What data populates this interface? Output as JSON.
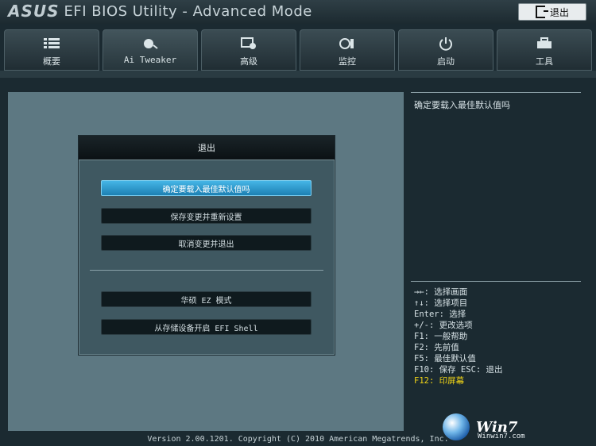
{
  "header": {
    "brand": "ASUS",
    "title": "EFI BIOS Utility - Advanced Mode",
    "exit_label": "退出"
  },
  "tabs": [
    {
      "label": "概要",
      "icon": "list-icon"
    },
    {
      "label": "Ai Tweaker",
      "icon": "ai-tweaker-icon"
    },
    {
      "label": "高级",
      "icon": "advanced-icon"
    },
    {
      "label": "监控",
      "icon": "monitor-icon"
    },
    {
      "label": "启动",
      "icon": "power-icon"
    },
    {
      "label": "工具",
      "icon": "toolbox-icon"
    }
  ],
  "dialog": {
    "title": "退出",
    "buttons": [
      "确定要载入最佳默认值吗",
      "保存变更并重新设置",
      "取消变更并退出",
      "华硕 EZ 模式",
      "从存储设备开启 EFI Shell"
    ]
  },
  "right_panel": {
    "description": "确定要载入最佳默认值吗",
    "hotkeys": [
      "→←: 选择画面",
      "↑↓: 选择项目",
      "Enter: 选择",
      "+/-: 更改选项",
      "F1: 一般帮助",
      "F2: 先前值",
      "F5: 最佳默认值",
      "F10: 保存  ESC: 退出"
    ],
    "hotkey_highlight": "F12: 印屏幕"
  },
  "footer": {
    "version": "Version 2.00.1201. Copyright (C) 2010 American Megatrends, Inc."
  },
  "watermark": {
    "text": "Win7",
    "site": "Winwin7.com"
  },
  "colors": {
    "selected_button": "#2b97cf",
    "highlight_text": "#f2d516",
    "background": "#1b2a31"
  }
}
